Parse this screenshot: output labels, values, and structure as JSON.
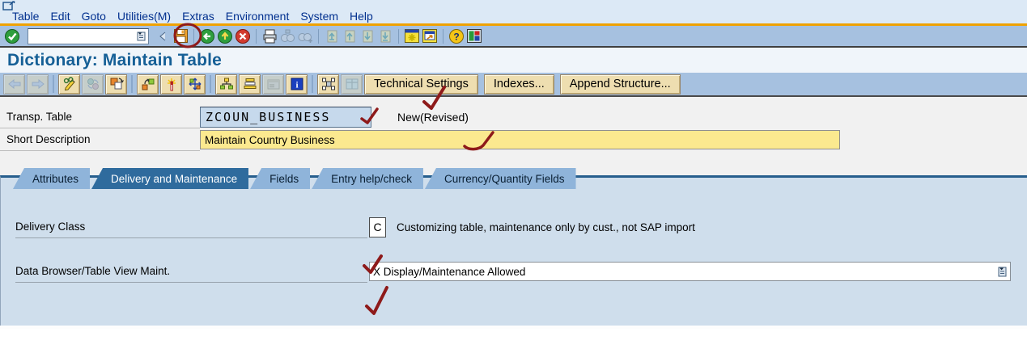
{
  "menu": {
    "items": [
      "Table",
      "Edit",
      "Goto",
      "Utilities(M)",
      "Extras",
      "Environment",
      "System",
      "Help"
    ]
  },
  "toolbar": {
    "command_field": {
      "value": "",
      "placeholder": ""
    },
    "icons": [
      "enter-icon",
      "command-dropdown-icon",
      "collapse-icon",
      "save-icon",
      "back-icon",
      "exit-icon",
      "cancel-icon",
      "print-icon",
      "find-icon",
      "find-next-icon",
      "first-page-icon",
      "page-up-icon",
      "page-down-icon",
      "last-page-icon",
      "new-session-icon",
      "create-shortcut-icon",
      "help-icon",
      "customize-layout-icon"
    ]
  },
  "header": {
    "title": "Dictionary: Maintain Table"
  },
  "appbar": {
    "icon_buttons": [
      "previous-icon",
      "next-icon",
      "display-change-icon",
      "refresh-icon",
      "copy-icon",
      "where-used-icon",
      "activate-icon",
      "runtime-object-icon",
      "hierarchy-icon",
      "sort-icon",
      "table-contents-icon",
      "documentation-icon",
      "graphic-icon",
      "grid-icon"
    ],
    "buttons": [
      {
        "label": "Technical Settings"
      },
      {
        "label": "Indexes..."
      },
      {
        "label": "Append Structure..."
      }
    ]
  },
  "form": {
    "transp_table": {
      "label": "Transp. Table",
      "value": "ZCOUN_BUSINESS",
      "status": "New(Revised)"
    },
    "short_description": {
      "label": "Short Description",
      "value": "Maintain Country Business"
    }
  },
  "tabs": {
    "items": [
      {
        "label": "Attributes",
        "active": false
      },
      {
        "label": "Delivery and Maintenance",
        "active": true
      },
      {
        "label": "Fields",
        "active": false
      },
      {
        "label": "Entry help/check",
        "active": false
      },
      {
        "label": "Currency/Quantity Fields",
        "active": false
      }
    ]
  },
  "panel": {
    "delivery_class": {
      "label": "Delivery Class",
      "value": "C",
      "description": "Customizing table, maintenance only by cust., not SAP import"
    },
    "data_browser": {
      "label": "Data Browser/Table View Maint.",
      "value": "X Display/Maintenance Allowed"
    }
  },
  "colors": {
    "annotation_red": "#8e1a1a",
    "accent_orange": "#f0a202",
    "title_blue": "#155f96",
    "active_tab": "#2f6b9d",
    "panel_bg": "#cfdeec",
    "field_yellow": "#fbe98f",
    "field_blue": "#c6d9ec",
    "button_tan": "#eedeb0"
  }
}
